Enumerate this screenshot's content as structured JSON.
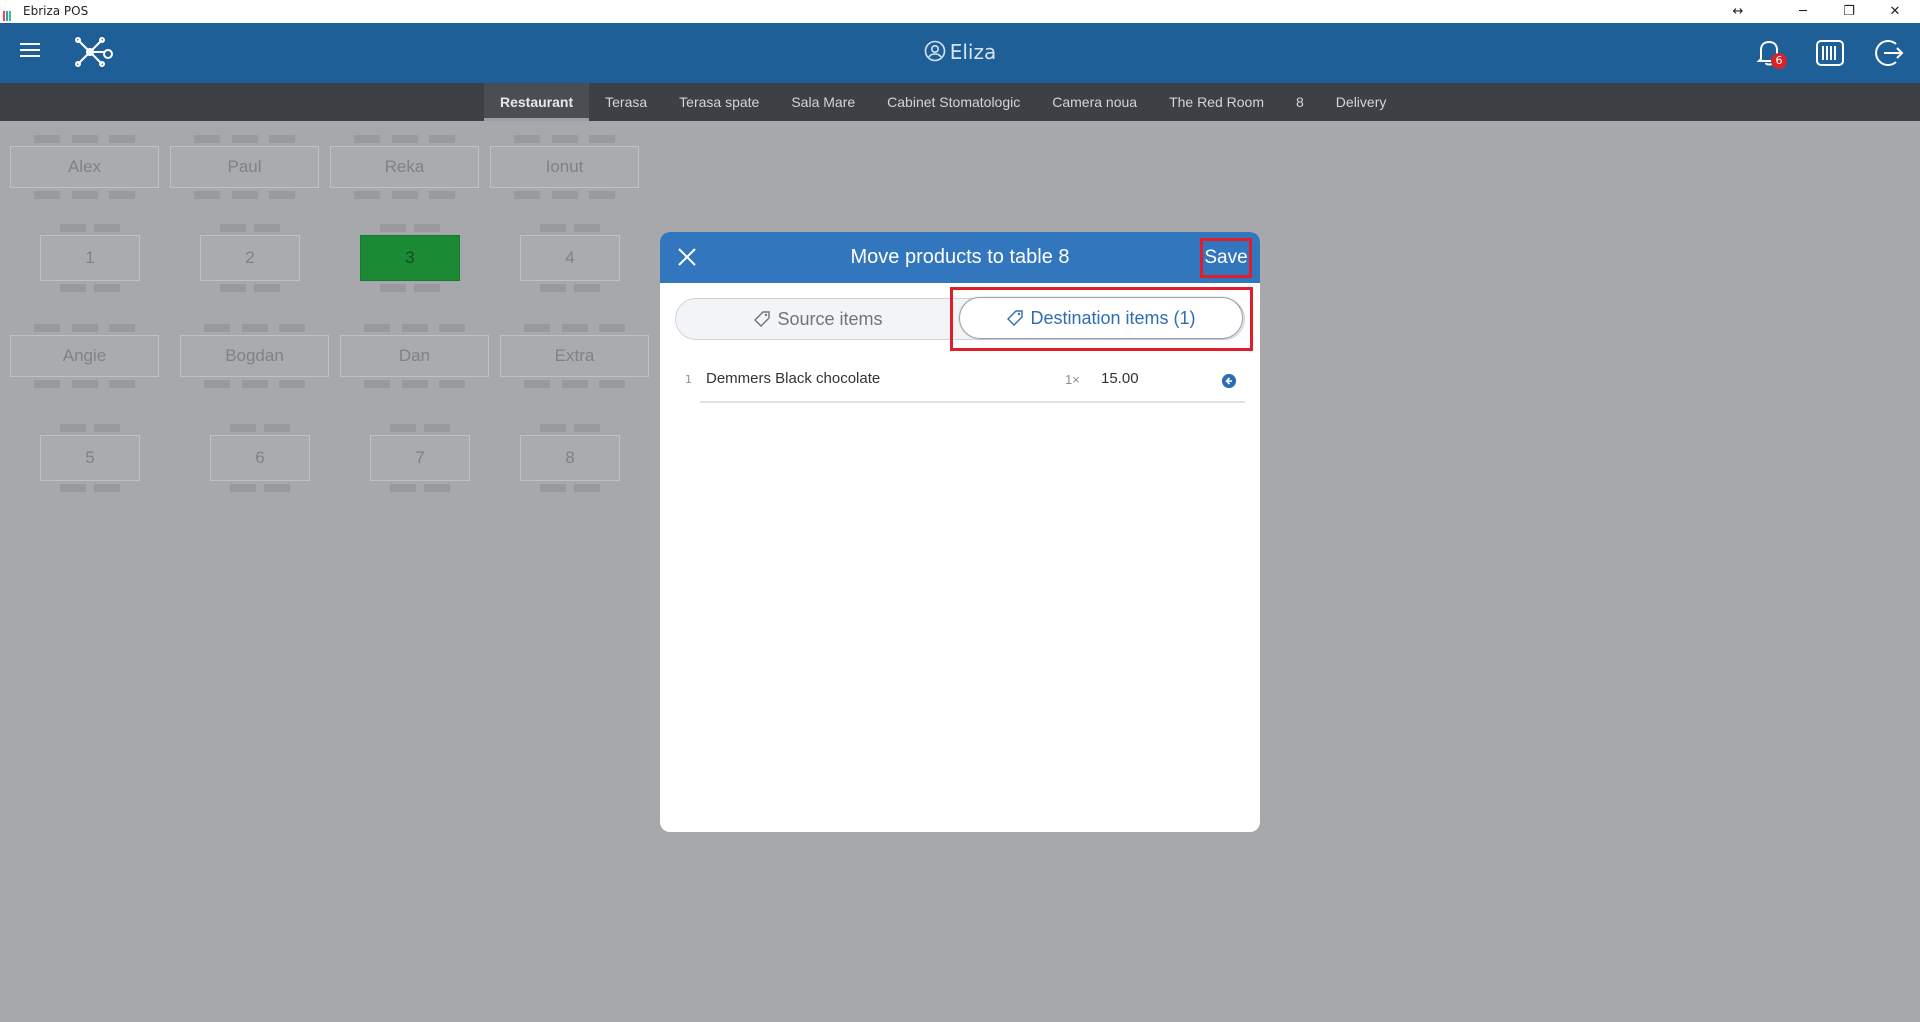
{
  "window": {
    "title": "Ebriza POS",
    "logo_colors": [
      "#e74c3c",
      "#3498db",
      "#2ecc71",
      "#f1c40f"
    ],
    "controls": {
      "resize": "↔",
      "minimize": "─",
      "restore": "❐",
      "close": "✕"
    }
  },
  "header": {
    "user_name": "Eliza",
    "notifications_count": "6",
    "icons": [
      "menu-icon",
      "network-icon",
      "user-icon",
      "bell-icon",
      "receipt-icon",
      "logout-icon"
    ]
  },
  "tabs": [
    {
      "label": "Restaurant",
      "active": true
    },
    {
      "label": "Terasa",
      "active": false
    },
    {
      "label": "Terasa spate",
      "active": false
    },
    {
      "label": "Sala Mare",
      "active": false
    },
    {
      "label": "Cabinet Stomatologic",
      "active": false
    },
    {
      "label": "Camera noua",
      "active": false
    },
    {
      "label": "The Red Room",
      "active": false
    },
    {
      "label": "8",
      "active": false
    },
    {
      "label": "Delivery",
      "active": false
    }
  ],
  "tables": [
    {
      "label": "Alex",
      "occupied": false
    },
    {
      "label": "Paul",
      "occupied": false
    },
    {
      "label": "Reka",
      "occupied": false
    },
    {
      "label": "Ionut",
      "occupied": false
    },
    {
      "label": "1",
      "occupied": false
    },
    {
      "label": "2",
      "occupied": false
    },
    {
      "label": "3",
      "occupied": true
    },
    {
      "label": "4",
      "occupied": false
    },
    {
      "label": "Angie",
      "occupied": false
    },
    {
      "label": "Bogdan",
      "occupied": false
    },
    {
      "label": "Dan",
      "occupied": false
    },
    {
      "label": "Extra",
      "occupied": false
    },
    {
      "label": "5",
      "occupied": false
    },
    {
      "label": "6",
      "occupied": false
    },
    {
      "label": "7",
      "occupied": false
    },
    {
      "label": "8",
      "occupied": false
    }
  ],
  "modal": {
    "title": "Move products to table 8",
    "save_label": "Save",
    "source_tab_label": "Source items",
    "destination_tab_label": "Destination items (1)",
    "items": [
      {
        "index": "1",
        "name": "Demmers Black chocolate",
        "qty": "1×",
        "price": "15.00"
      }
    ]
  },
  "colors": {
    "header": "#1f5f98",
    "modal_header": "#3276bd",
    "occupied_table": "#1a8a35",
    "highlight": "#e11d2a"
  }
}
